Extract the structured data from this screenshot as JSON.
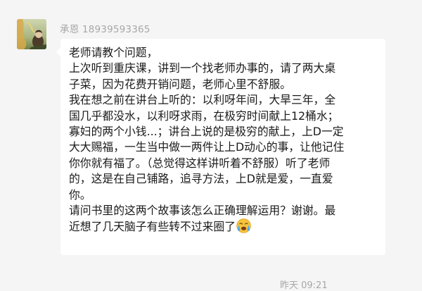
{
  "message": {
    "sender_name": "承恩",
    "sender_phone": "18939593365",
    "lines": [
      "老师请教个问题，",
      "上次听到重庆课，讲到一个找老师办事的，请了两大桌",
      "子菜，因为花费开销问题，老师心里不舒服。",
      "我在想之前在讲台上听的：以利呀年间，大旱三年，全",
      "国几乎都没水，以利呀求雨，在极穷时间献上12桶水；",
      "寡妇的两个小钱...；讲台上说的是极穷的献上，上D一定",
      "大大赐福，一生当中做一两件让上D动心的事，让他记住",
      "你你就有福了。（总觉得这样讲听着不舒服）听了老师",
      "的，这是在自己铺路，追寻方法，上D就是爱，一直爱",
      "你。",
      "请问书里的这两个故事该怎么正确理解运用？谢谢。最",
      "近想了几天脑子有些转不过来圈了"
    ],
    "emoji_icon": "crying-face-emoji-icon",
    "timestamp": "昨天 09:21"
  },
  "colors": {
    "background": "#f5f5f5",
    "bubble": "#ffffff",
    "meta_text": "#a7a7a7",
    "message_text": "#1a1a1a"
  }
}
